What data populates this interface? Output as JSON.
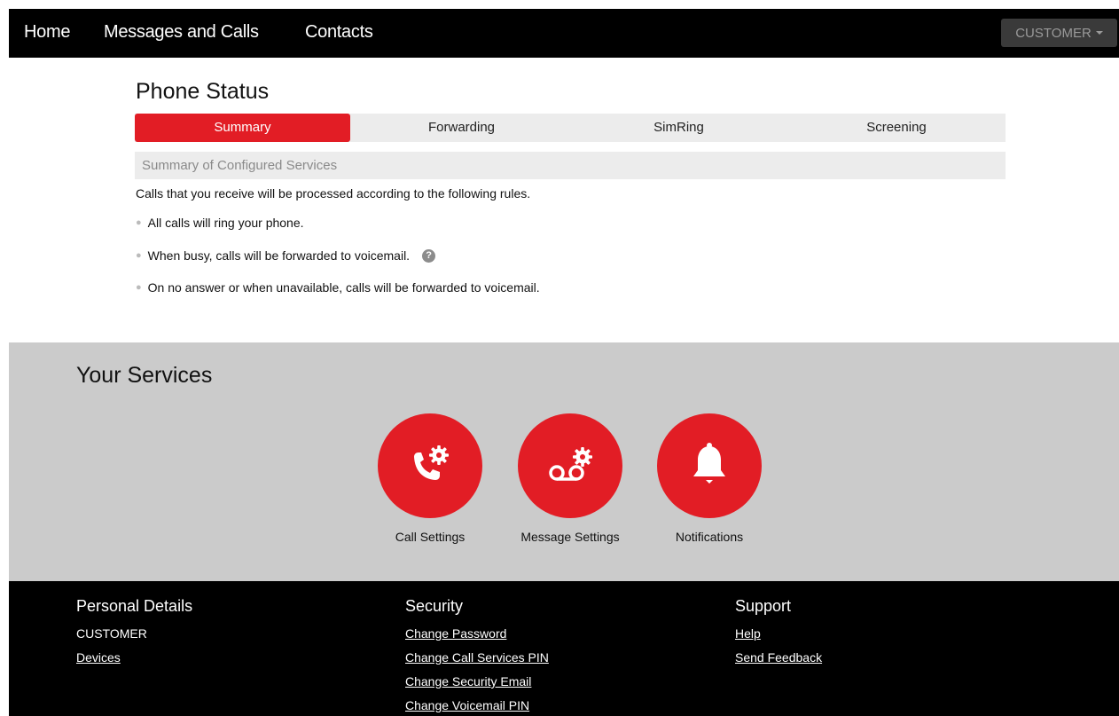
{
  "nav": {
    "links": [
      "Home",
      "Messages and Calls",
      "Contacts"
    ],
    "user_label": "CUSTOMER"
  },
  "phone_status": {
    "title": "Phone Status",
    "tabs": [
      "Summary",
      "Forwarding",
      "SimRing",
      "Screening"
    ],
    "active_tab": "Summary",
    "summary_header": "Summary of Configured Services",
    "intro": "Calls that you receive will be processed according to the following rules.",
    "rules": [
      "All calls will ring your phone.",
      "When busy, calls will be forwarded to voicemail.",
      "On no answer or when unavailable, calls will be forwarded to voicemail."
    ]
  },
  "services": {
    "title": "Your Services",
    "items": [
      {
        "label": "Call Settings",
        "icon": "phone-gear-icon"
      },
      {
        "label": "Message Settings",
        "icon": "voicemail-gear-icon"
      },
      {
        "label": "Notifications",
        "icon": "bell-icon"
      }
    ]
  },
  "footer": {
    "personal": {
      "heading": "Personal Details",
      "name": "CUSTOMER",
      "links": [
        "Devices"
      ]
    },
    "security": {
      "heading": "Security",
      "links": [
        "Change Password",
        "Change Call Services PIN",
        "Change Security Email",
        "Change Voicemail PIN"
      ]
    },
    "support": {
      "heading": "Support",
      "links": [
        "Help",
        "Send Feedback"
      ]
    }
  },
  "colors": {
    "accent": "#e21d25",
    "nav_bg": "#000000",
    "services_bg": "#cbcbcb",
    "tab_bg": "#ececec"
  }
}
